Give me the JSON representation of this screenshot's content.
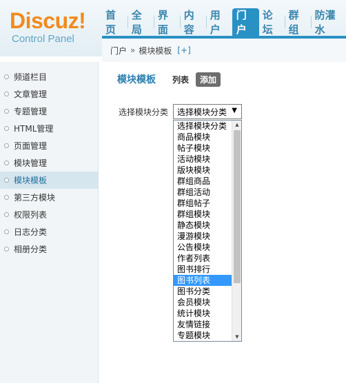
{
  "logo": {
    "brand": "Discuz!",
    "subtitle": "Control Panel"
  },
  "topnav": [
    {
      "label": "首页",
      "active": false
    },
    {
      "label": "全局",
      "active": false
    },
    {
      "label": "界面",
      "active": false
    },
    {
      "label": "内容",
      "active": false
    },
    {
      "label": "用户",
      "active": false
    },
    {
      "label": "门户",
      "active": true
    },
    {
      "label": "论坛",
      "active": false
    },
    {
      "label": "群组",
      "active": false
    },
    {
      "label": "防灌水",
      "active": false
    }
  ],
  "breadcrumb": {
    "root": "门户",
    "separator": "»",
    "current": "模块模板",
    "add": "[+]"
  },
  "sidebar": {
    "items": [
      {
        "label": "频道栏目",
        "active": false
      },
      {
        "label": "文章管理",
        "active": false
      },
      {
        "label": "专题管理",
        "active": false
      },
      {
        "label": "HTML管理",
        "active": false
      },
      {
        "label": "页面管理",
        "active": false
      },
      {
        "label": "模块管理",
        "active": false
      },
      {
        "label": "模块模板",
        "active": true
      },
      {
        "label": "第三方模块",
        "active": false
      },
      {
        "label": "权限列表",
        "active": false
      },
      {
        "label": "日志分类",
        "active": false
      },
      {
        "label": "相册分类",
        "active": false
      }
    ]
  },
  "main": {
    "title": "模块模板",
    "tab_list": "列表",
    "tab_add": "添加",
    "field_label": "选择模块分类",
    "select_value": "选择模块分类",
    "select_arrow": "▼",
    "options": [
      "选择模块分类",
      "商品模块",
      "帖子模块",
      "活动模块",
      "版块模块",
      "群组商品",
      "群组活动",
      "群组帖子",
      "群组模块",
      "静态模块",
      "漫游模块",
      "公告模块",
      "作者列表",
      "图书排行",
      "图书列表",
      "图书分类",
      "会员模块",
      "统计模块",
      "友情链接",
      "专题模块"
    ],
    "selected_option": "图书列表",
    "scroll_up": "▲",
    "scroll_down": "▼"
  },
  "colors": {
    "accent": "#2a91c4",
    "logo_orange": "#f28a1e",
    "selected_bg": "#3399ff"
  }
}
